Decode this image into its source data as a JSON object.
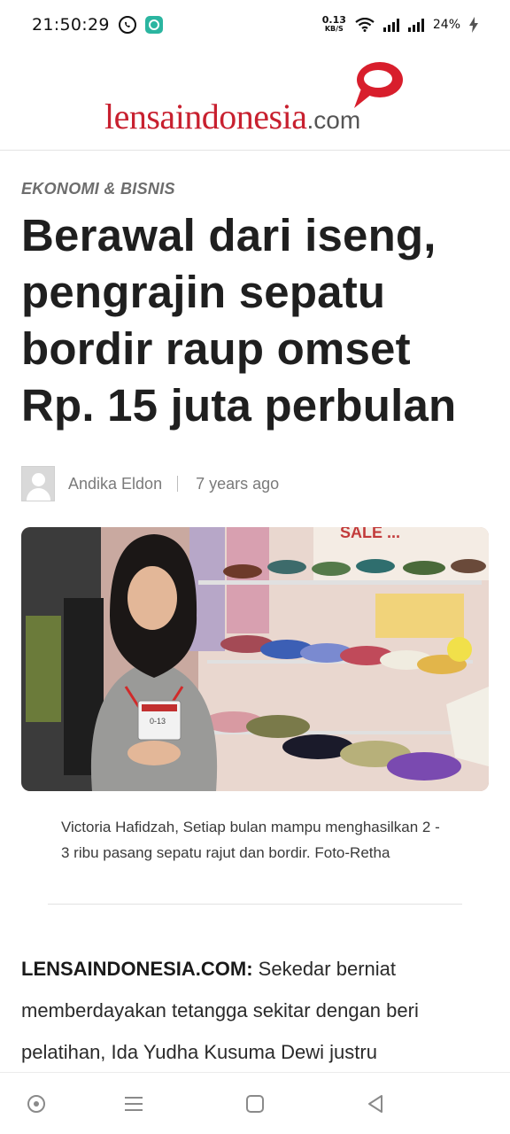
{
  "status_bar": {
    "time": "21:50:29",
    "net_speed_value": "0.13",
    "net_speed_unit": "KB/S",
    "battery": "24%"
  },
  "site": {
    "logo_main": "lensaindonesia",
    "logo_suffix": ".com",
    "brand_color": "#c8202f"
  },
  "article": {
    "category": "EKONOMI & BISNIS",
    "headline": "Berawal dari iseng, pengrajin sepatu bordir raup omset Rp. 15 juta perbulan",
    "author": "Andika Eldon",
    "date": "7 years ago",
    "caption": "Victoria Hafidzah, Setiap bulan mampu menghasilkan 2 - 3 ribu pasang sepatu rajut dan bordir. Foto-Retha",
    "body_lead": "LENSAINDONESIA.COM:",
    "body_text": " Sekedar berniat memberdayakan tetangga sekitar dengan beri pelatihan, Ida Yudha Kusuma Dewi justru",
    "photo_sign_text": "SALE ...",
    "badge_text": "0-13"
  },
  "nav_bar": {
    "icons": [
      "assistant-icon",
      "menu-icon",
      "home-icon",
      "back-icon"
    ]
  }
}
